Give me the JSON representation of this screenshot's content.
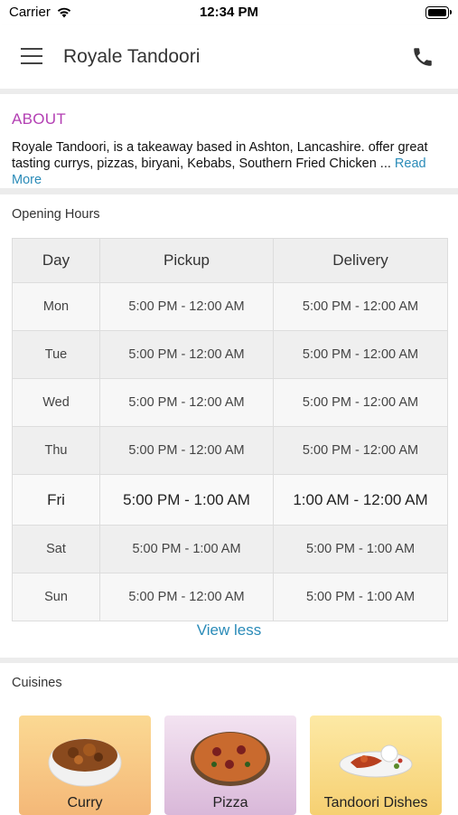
{
  "status_bar": {
    "carrier": "Carrier",
    "time": "12:34 PM"
  },
  "header": {
    "title": "Royale Tandoori"
  },
  "about": {
    "heading": "ABOUT",
    "text": "Royale Tandoori, is a takeaway based in Ashton, Lancashire. offer great tasting currys, pizzas, biryani, Kebabs, Southern Fried Chicken ...",
    "read_more": "Read More"
  },
  "opening_hours": {
    "heading": "Opening Hours",
    "columns": [
      "Day",
      "Pickup",
      "Delivery"
    ],
    "rows": [
      {
        "day": "Mon",
        "pickup": "5:00 PM - 12:00 AM",
        "delivery": "5:00 PM - 12:00 AM"
      },
      {
        "day": "Tue",
        "pickup": "5:00 PM - 12:00 AM",
        "delivery": "5:00 PM - 12:00 AM"
      },
      {
        "day": "Wed",
        "pickup": "5:00 PM - 12:00 AM",
        "delivery": "5:00 PM - 12:00 AM"
      },
      {
        "day": "Thu",
        "pickup": "5:00 PM - 12:00 AM",
        "delivery": "5:00 PM - 12:00 AM"
      },
      {
        "day": "Fri",
        "pickup": "5:00 PM - 1:00 AM",
        "delivery": "1:00 AM - 12:00 AM"
      },
      {
        "day": "Sat",
        "pickup": "5:00 PM - 1:00 AM",
        "delivery": "5:00 PM - 1:00 AM"
      },
      {
        "day": "Sun",
        "pickup": "5:00 PM - 12:00 AM",
        "delivery": "5:00 PM - 1:00 AM"
      }
    ],
    "view_less": "View less"
  },
  "cuisines": {
    "heading": "Cuisines",
    "items": [
      {
        "name": "Curry",
        "icon": "curry-bowl-icon",
        "color_top": "#fbd993",
        "color_bottom": "#f4b878"
      },
      {
        "name": "Pizza",
        "icon": "pizza-icon",
        "color_top": "#f3e3f1",
        "color_bottom": "#d9b8d9"
      },
      {
        "name": "Tandoori Dishes",
        "icon": "tandoori-plate-icon",
        "color_top": "#fde9a5",
        "color_bottom": "#f6d072"
      }
    ]
  },
  "colors": {
    "accent_purple": "#b33fb3",
    "link_blue": "#2a8bb8",
    "divider_gray": "#ececec"
  }
}
